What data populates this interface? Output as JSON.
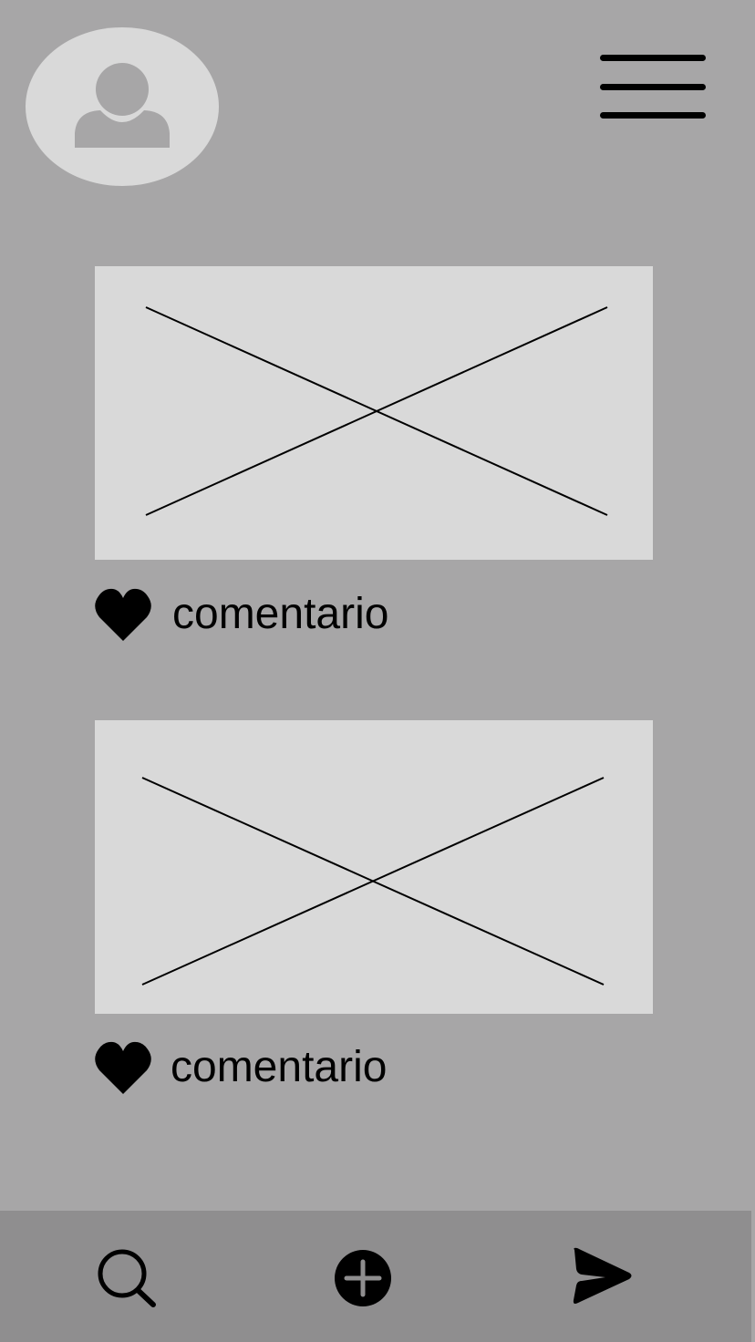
{
  "header": {
    "avatar_icon": "user-icon",
    "menu_icon": "hamburger-menu-icon"
  },
  "feed": {
    "posts": [
      {
        "image_icon": "image-placeholder-icon",
        "like_icon": "heart-icon",
        "comment_label": "comentario"
      },
      {
        "image_icon": "image-placeholder-icon",
        "like_icon": "heart-icon",
        "comment_label": "comentario"
      }
    ]
  },
  "bottom_nav": {
    "items": [
      {
        "icon": "search-icon"
      },
      {
        "icon": "plus-circle-icon"
      },
      {
        "icon": "send-icon"
      }
    ]
  },
  "colors": {
    "background": "#a7a6a7",
    "placeholder": "#d9d9d9",
    "bottom_bar": "#8f8e8f",
    "foreground": "#000000"
  }
}
